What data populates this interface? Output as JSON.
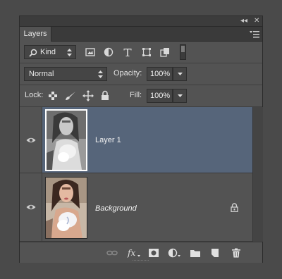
{
  "panel": {
    "collapse_glyph": "◂◂",
    "close_glyph": "✕",
    "tab_label": "Layers",
    "tab_menu_icon": "panel-menu-icon"
  },
  "filter_row": {
    "kind_label": "Kind",
    "icons": [
      "image-filter-icon",
      "adjustment-filter-icon",
      "type-filter-icon",
      "shape-filter-icon",
      "smart-object-filter-icon",
      "filter-toggle-icon"
    ]
  },
  "blend_row": {
    "blend_mode": "Normal",
    "opacity_label": "Opacity:",
    "opacity_value": "100%"
  },
  "lock_row": {
    "lock_label": "Lock:",
    "fill_label": "Fill:",
    "fill_value": "100%",
    "icons": [
      "lock-transparent-icon",
      "lock-image-icon",
      "lock-position-icon",
      "lock-all-icon"
    ]
  },
  "layers": [
    {
      "name": "Layer 1",
      "visible": true,
      "selected": true,
      "italic": false,
      "locked": false
    },
    {
      "name": "Background",
      "visible": true,
      "selected": false,
      "italic": true,
      "locked": true
    }
  ],
  "bottom_bar": {
    "icons": [
      "link-layers-icon",
      "layer-style-fx-icon",
      "layer-mask-icon",
      "adjustment-layer-icon",
      "new-group-icon",
      "new-layer-icon",
      "delete-layer-icon"
    ]
  },
  "colors": {
    "panel_bg": "#535353",
    "selected_bg": "#56657a",
    "control_bg": "#454545",
    "text": "#e6e6e6"
  }
}
